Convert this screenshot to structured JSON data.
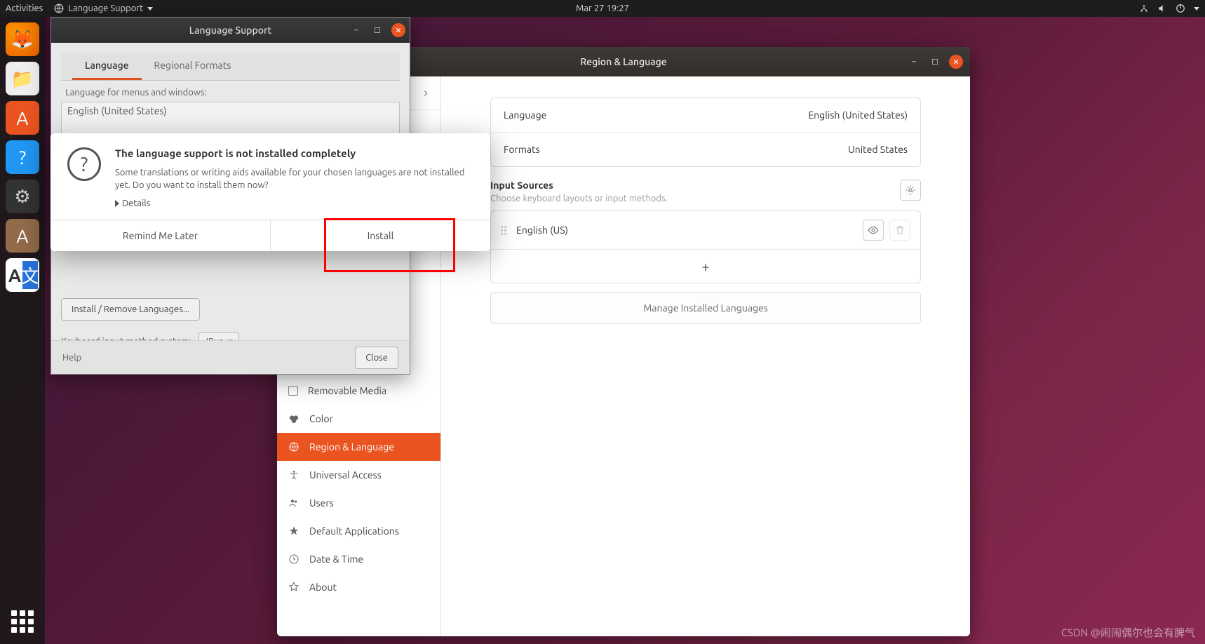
{
  "topbar": {
    "activities": "Activities",
    "app_menu": "Language Support",
    "clock": "Mar 27  19:27"
  },
  "lang_support": {
    "title": "Language Support",
    "tabs": {
      "language": "Language",
      "regional": "Regional Formats"
    },
    "caption": "Language for menus and windows:",
    "list_item": "English (United States)",
    "install_remove": "Install / Remove Languages...",
    "ims_label": "Keyboard input method system:",
    "ims_value": "IBus",
    "help": "Help",
    "close": "Close"
  },
  "modal": {
    "heading": "The language support is not installed completely",
    "message": "Some translations or writing aids available for your chosen languages are not installed yet. Do you want to install them now?",
    "details": "Details",
    "remind": "Remind Me Later",
    "install": "Install"
  },
  "settings": {
    "title": "Region & Language",
    "sidebar": {
      "removable": "Removable Media",
      "color": "Color",
      "region": "Region & Language",
      "access": "Universal Access",
      "users": "Users",
      "default_apps": "Default Applications",
      "datetime": "Date & Time",
      "about": "About"
    },
    "content": {
      "language_label": "Language",
      "language_value": "English (United States)",
      "formats_label": "Formats",
      "formats_value": "United States",
      "input_sources": "Input Sources",
      "input_hint": "Choose keyboard layouts or input methods.",
      "english_us": "English (US)",
      "add": "+",
      "manage": "Manage Installed Languages"
    }
  },
  "watermark": "CSDN @闹闹偶尔也会有脾气"
}
